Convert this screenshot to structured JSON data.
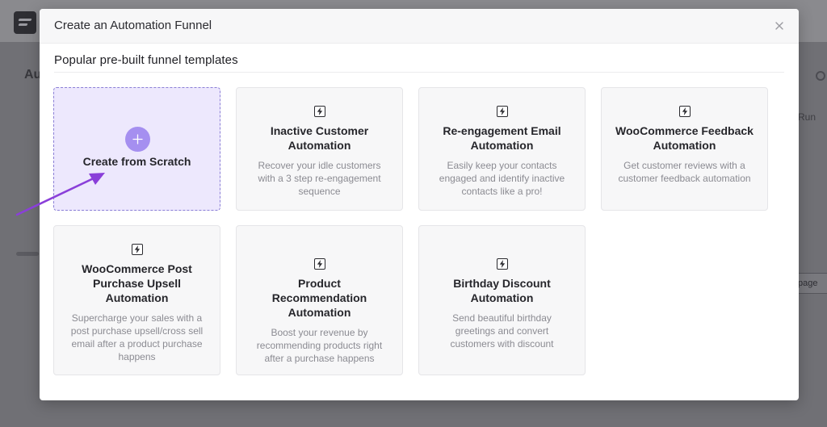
{
  "background": {
    "heading": "Au",
    "run_label": "Run",
    "page_button": "page"
  },
  "modal": {
    "title": "Create an Automation Funnel",
    "close_icon": "close-icon",
    "section_title": "Popular pre-built funnel templates",
    "scratch_card": {
      "label": "Create from Scratch",
      "icon": "plus-icon"
    },
    "templates": [
      {
        "title": "Inactive Customer Automation",
        "description": "Recover your idle customers with a 3 step re-engagement sequence",
        "icon": "bolt-icon"
      },
      {
        "title": "Re-engagement Email Automation",
        "description": "Easily keep your contacts engaged and identify inactive contacts like a pro!",
        "icon": "bolt-icon"
      },
      {
        "title": "WooCommerce Feedback Automation",
        "description": "Get customer reviews with a customer feedback automation",
        "icon": "bolt-icon"
      },
      {
        "title": "WooCommerce Post Purchase Upsell Automation",
        "description": "Supercharge your sales with a post purchase upsell/cross sell email after a product purchase happens",
        "icon": "bolt-icon"
      },
      {
        "title": "Product Recommendation Automation",
        "description": "Boost your revenue by recommending products right after a purchase happens",
        "icon": "bolt-icon"
      },
      {
        "title": "Birthday Discount Automation",
        "description": "Send beautiful birthday greetings and convert customers with discount",
        "icon": "bolt-icon"
      }
    ]
  },
  "colors": {
    "accent": "#a58ff0",
    "scratch_bg": "#ede8fd",
    "arrow": "#8a3fd9"
  }
}
